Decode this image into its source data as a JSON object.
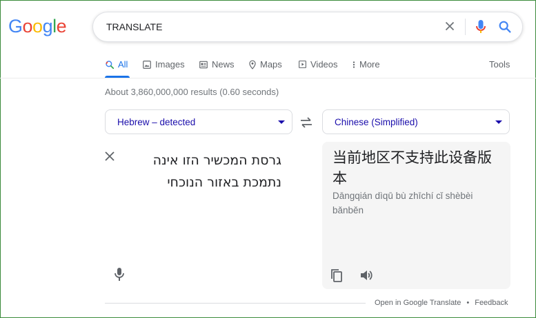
{
  "logo": {
    "letters": [
      {
        "ch": "G",
        "color": "#4285F4"
      },
      {
        "ch": "o",
        "color": "#EA4335"
      },
      {
        "ch": "o",
        "color": "#FBBC05"
      },
      {
        "ch": "g",
        "color": "#4285F4"
      },
      {
        "ch": "l",
        "color": "#34A853"
      },
      {
        "ch": "e",
        "color": "#EA4335"
      }
    ]
  },
  "search": {
    "query": "TRANSLATE"
  },
  "tabs": [
    {
      "label": "All",
      "icon": "search-icon",
      "active": true
    },
    {
      "label": "Images",
      "icon": "image-icon"
    },
    {
      "label": "News",
      "icon": "news-icon"
    },
    {
      "label": "Maps",
      "icon": "map-pin-icon"
    },
    {
      "label": "Videos",
      "icon": "video-icon"
    },
    {
      "label": "More",
      "icon": "more-vert-icon"
    }
  ],
  "tools_label": "Tools",
  "stats": "About 3,860,000,000 results (0.60 seconds)",
  "translate": {
    "source_lang": "Hebrew – detected",
    "target_lang": "Chinese (Simplified)",
    "source_text": "גרסת המכשיר הזו אינה נתמכת באזור הנוכחי",
    "target_text": "当前地区不支持此设备版本",
    "target_pinyin": "Dāngqián dìqū bù zhīchí cǐ shèbèi bǎnběn"
  },
  "footer": {
    "open_link": "Open in Google Translate",
    "separator": "•",
    "feedback": "Feedback"
  },
  "colors": {
    "accent": "#1a73e8",
    "link": "#1a0dab",
    "frame": "#3a8a3a"
  }
}
